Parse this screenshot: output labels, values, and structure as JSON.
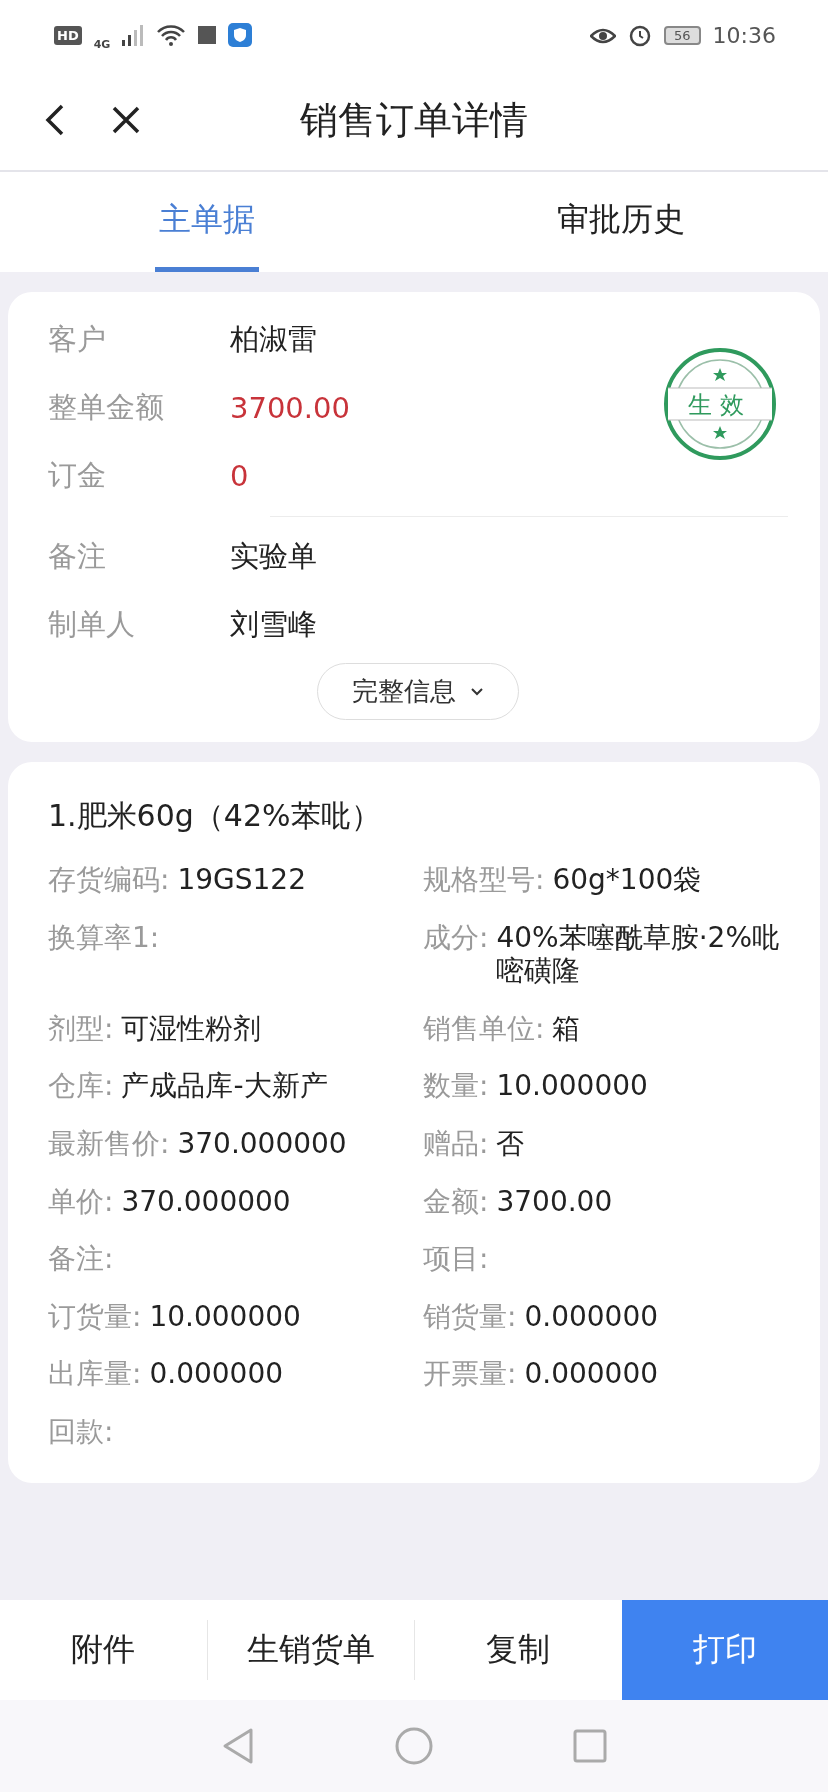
{
  "status_bar": {
    "network_badge": "HD",
    "signal_type": "4G",
    "battery": "56",
    "time": "10:36"
  },
  "header": {
    "title": "销售订单详情"
  },
  "tabs": [
    {
      "label": "主单据",
      "selected": true
    },
    {
      "label": "审批历史",
      "selected": false
    }
  ],
  "summary": {
    "fields": [
      {
        "label": "客户",
        "value": "柏淑雷",
        "color": "#222222"
      },
      {
        "label": "整单金额",
        "value": "3700.00",
        "color": "#c8333a"
      },
      {
        "label": "订金",
        "value": "0",
        "color": "#c8333a"
      }
    ],
    "extra_fields": [
      {
        "label": "备注",
        "value": "实验单",
        "color": "#222222"
      },
      {
        "label": "制单人",
        "value": "刘雪峰",
        "color": "#222222"
      }
    ],
    "stamp": {
      "text": "生效"
    },
    "more_button": "完整信息"
  },
  "items": [
    {
      "title": "1.肥米60g（42%苯吡）",
      "fields": [
        {
          "label": "存货编码:",
          "value": "19GS122"
        },
        {
          "label": "规格型号:",
          "value": "60g*100袋"
        },
        {
          "label": "换算率1:"
        },
        {
          "label": "成分:",
          "value": "40%苯噻酰草胺·2%吡嘧磺隆"
        },
        {
          "label": "剂型:",
          "value": "可湿性粉剂"
        },
        {
          "label": "销售单位:",
          "value": "箱"
        },
        {
          "label": "仓库:",
          "value": "产成品库-大新产"
        },
        {
          "label": "数量:",
          "value": "10.000000"
        },
        {
          "label": "最新售价:",
          "value": "370.000000"
        },
        {
          "label": "赠品:",
          "value": "否"
        },
        {
          "label": "单价:",
          "value": "370.000000"
        },
        {
          "label": "金额:",
          "value": "3700.00"
        },
        {
          "label": "备注:"
        },
        {
          "label": "项目:"
        },
        {
          "label": "订货量:",
          "value": "10.000000"
        },
        {
          "label": "销货量:",
          "value": "0.000000"
        },
        {
          "label": "出库量:",
          "value": "0.000000"
        },
        {
          "label": "开票量:",
          "value": "0.000000"
        },
        {
          "label": "回款:"
        }
      ]
    }
  ],
  "actions": [
    {
      "label": "附件",
      "kind": "plain"
    },
    {
      "label": "生销货单",
      "kind": "plain"
    },
    {
      "label": "复制",
      "kind": "plain"
    },
    {
      "label": "打印",
      "kind": "primary"
    }
  ]
}
